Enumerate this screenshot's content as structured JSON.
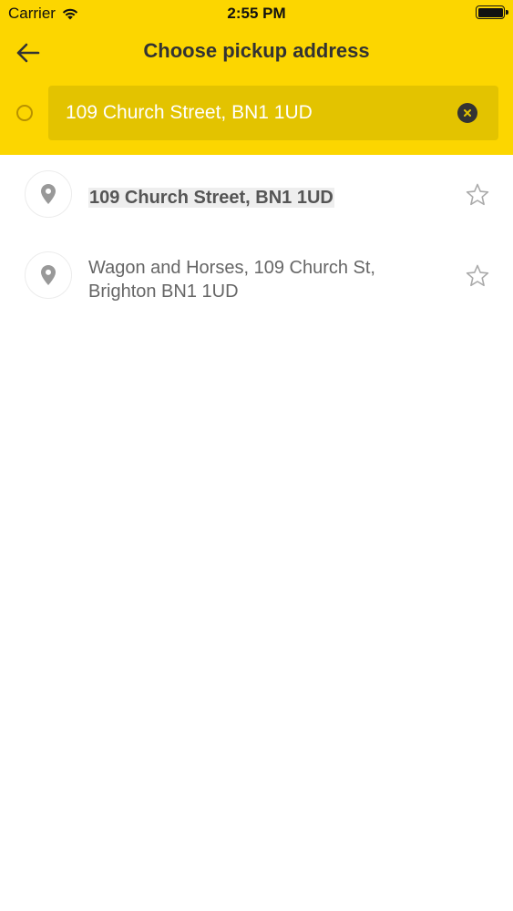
{
  "status_bar": {
    "carrier": "Carrier",
    "time": "2:55 PM"
  },
  "nav": {
    "title": "Choose pickup address",
    "back_icon": "arrow-left-icon"
  },
  "search": {
    "value": "109 Church Street, BN1 1UD",
    "clear_icon": "clear-icon"
  },
  "results": [
    {
      "text": "109 Church Street, BN1 1UD",
      "icon": "location-pin-icon",
      "favorite_icon": "star-outline-icon"
    },
    {
      "text": "Wagon and Horses, 109 Church St, Brighton BN1 1UD",
      "icon": "location-pin-icon",
      "favorite_icon": "star-outline-icon"
    }
  ],
  "colors": {
    "brand_yellow": "#FCD600",
    "search_field": "#E3C300",
    "text_dark": "#333333",
    "text_muted": "#666666"
  }
}
